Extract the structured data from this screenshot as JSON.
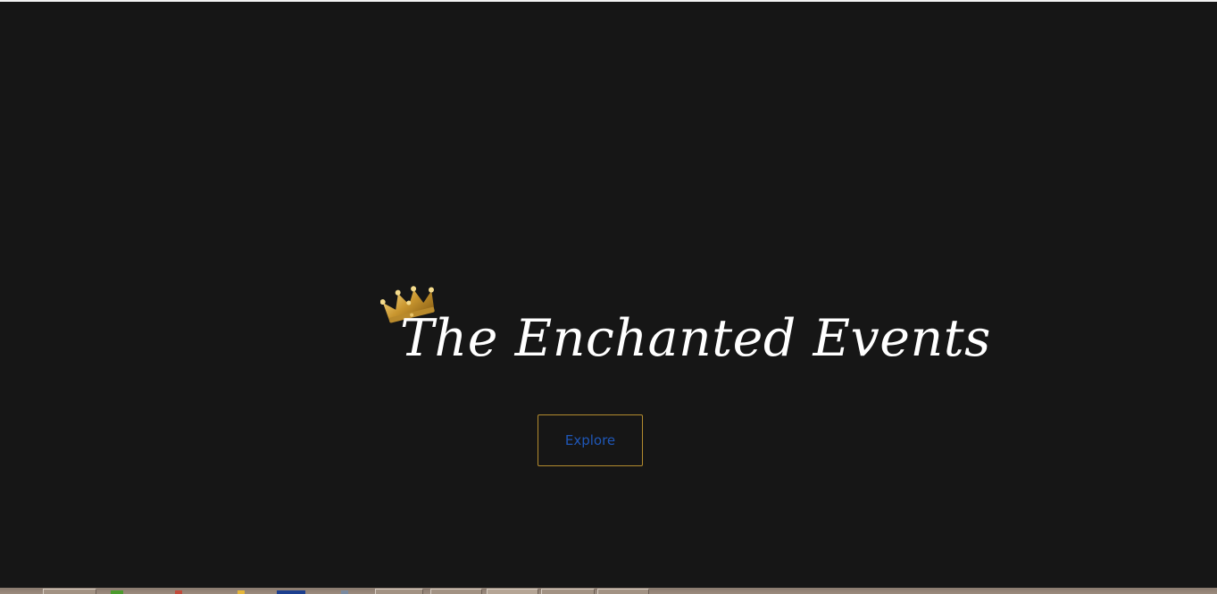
{
  "brand": {
    "title": "The Enchanted Events",
    "logo_icon": "crown-icon",
    "title_color": "#ffffff",
    "crown_color": "#d4a94a"
  },
  "hero": {
    "background_color": "#161616",
    "explore_label": "Explore",
    "explore_text_color": "#1f57b7",
    "explore_border_color": "#b38b2e"
  },
  "taskbar": {
    "icons": [
      "app-icon",
      "app-icon",
      "app-icon",
      "app-icon",
      "app-icon",
      "app-icon",
      "app-icon",
      "app-icon",
      "app-icon",
      "app-icon",
      "app-icon"
    ]
  }
}
